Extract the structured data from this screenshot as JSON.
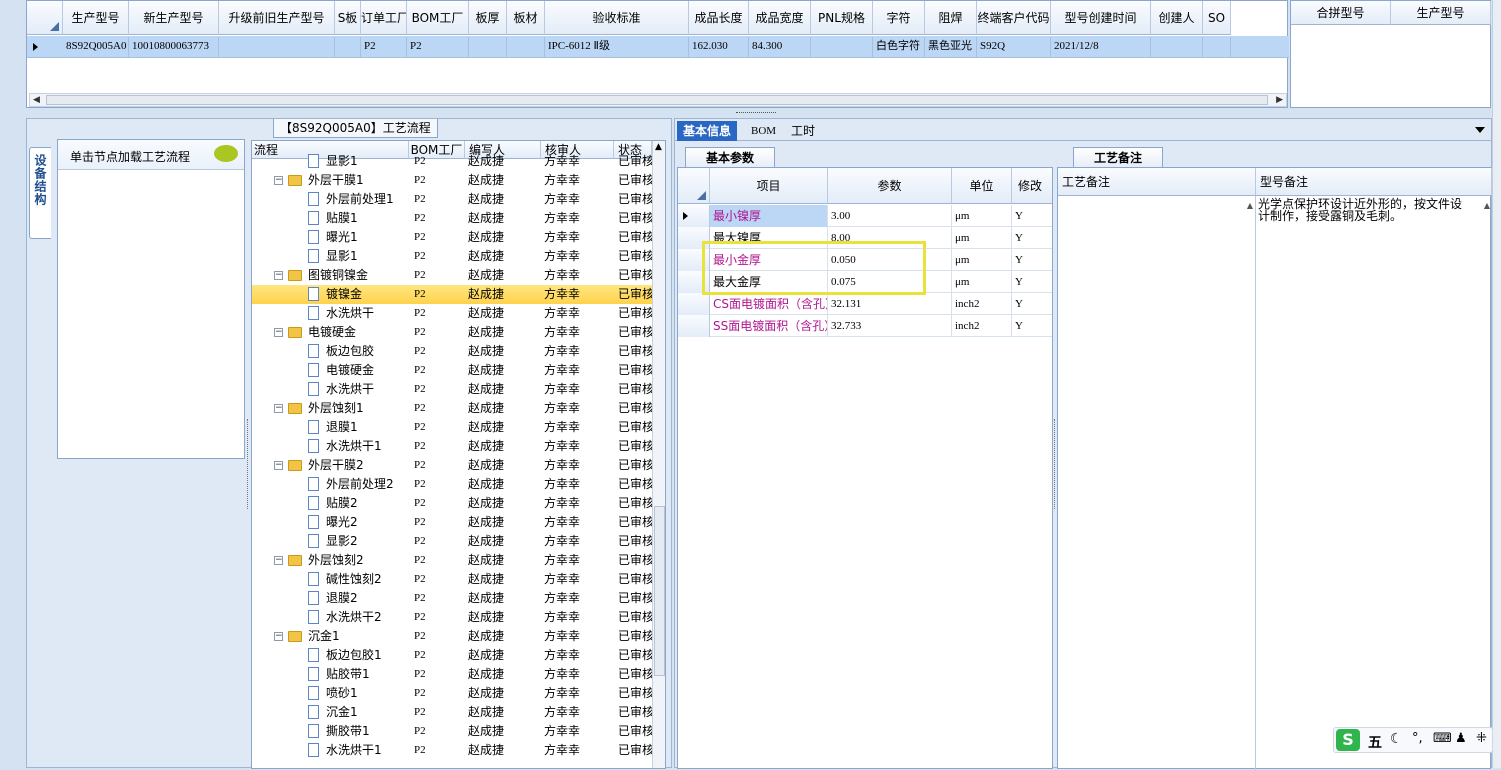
{
  "top_grid": {
    "columns": [
      "生产型号",
      "新生产型号",
      "升级前旧生产型号",
      "S板",
      "订单工厂",
      "BOM工厂",
      "板厚",
      "板材",
      "验收标准",
      "成品长度",
      "成品宽度",
      "PNL规格",
      "字符",
      "阻焊",
      "终端客户代码",
      "型号创建时间",
      "创建人",
      "SO"
    ],
    "row": [
      "8S92Q005A0",
      "10010800063773",
      "",
      "",
      "P2",
      "P2",
      "",
      "",
      "IPC-6012 Ⅱ级",
      "162.030",
      "84.300",
      "",
      "白色字符",
      "黑色亚光",
      "S92Q",
      "2021/12/8",
      "",
      ""
    ]
  },
  "side_grid": {
    "columns": [
      "合拼型号",
      "生产型号"
    ]
  },
  "process_panel": {
    "title": "【8S92Q005A0】工艺流程",
    "side_tab": "设备结构",
    "hint": "单击节点加载工艺流程",
    "columns": [
      "流程",
      "BOM工厂",
      "编写人",
      "核审人",
      "状态"
    ],
    "rows": [
      {
        "name": "显影1",
        "bom": "P2",
        "writer": "赵成捷",
        "reviewer": "方幸幸",
        "status": "已审核",
        "level": 2
      },
      {
        "name": "外层干膜1",
        "bom": "P2",
        "writer": "赵成捷",
        "reviewer": "方幸幸",
        "status": "已审核",
        "level": 1
      },
      {
        "name": "外层前处理1",
        "bom": "P2",
        "writer": "赵成捷",
        "reviewer": "方幸幸",
        "status": "已审核",
        "level": 2
      },
      {
        "name": "贴膜1",
        "bom": "P2",
        "writer": "赵成捷",
        "reviewer": "方幸幸",
        "status": "已审核",
        "level": 2
      },
      {
        "name": "曝光1",
        "bom": "P2",
        "writer": "赵成捷",
        "reviewer": "方幸幸",
        "status": "已审核",
        "level": 2
      },
      {
        "name": "显影1",
        "bom": "P2",
        "writer": "赵成捷",
        "reviewer": "方幸幸",
        "status": "已审核",
        "level": 2
      },
      {
        "name": "图镀铜镍金",
        "bom": "P2",
        "writer": "赵成捷",
        "reviewer": "方幸幸",
        "status": "已审核",
        "level": 1
      },
      {
        "name": "镀镍金",
        "bom": "P2",
        "writer": "赵成捷",
        "reviewer": "方幸幸",
        "status": "已审核",
        "level": 2,
        "selected": true
      },
      {
        "name": "水洗烘干",
        "bom": "P2",
        "writer": "赵成捷",
        "reviewer": "方幸幸",
        "status": "已审核",
        "level": 2
      },
      {
        "name": "电镀硬金",
        "bom": "P2",
        "writer": "赵成捷",
        "reviewer": "方幸幸",
        "status": "已审核",
        "level": 1
      },
      {
        "name": "板边包胶",
        "bom": "P2",
        "writer": "赵成捷",
        "reviewer": "方幸幸",
        "status": "已审核",
        "level": 2
      },
      {
        "name": "电镀硬金",
        "bom": "P2",
        "writer": "赵成捷",
        "reviewer": "方幸幸",
        "status": "已审核",
        "level": 2
      },
      {
        "name": "水洗烘干",
        "bom": "P2",
        "writer": "赵成捷",
        "reviewer": "方幸幸",
        "status": "已审核",
        "level": 2
      },
      {
        "name": "外层蚀刻1",
        "bom": "P2",
        "writer": "赵成捷",
        "reviewer": "方幸幸",
        "status": "已审核",
        "level": 1
      },
      {
        "name": "退膜1",
        "bom": "P2",
        "writer": "赵成捷",
        "reviewer": "方幸幸",
        "status": "已审核",
        "level": 2
      },
      {
        "name": "水洗烘干1",
        "bom": "P2",
        "writer": "赵成捷",
        "reviewer": "方幸幸",
        "status": "已审核",
        "level": 2
      },
      {
        "name": "外层干膜2",
        "bom": "P2",
        "writer": "赵成捷",
        "reviewer": "方幸幸",
        "status": "已审核",
        "level": 1
      },
      {
        "name": "外层前处理2",
        "bom": "P2",
        "writer": "赵成捷",
        "reviewer": "方幸幸",
        "status": "已审核",
        "level": 2
      },
      {
        "name": "贴膜2",
        "bom": "P2",
        "writer": "赵成捷",
        "reviewer": "方幸幸",
        "status": "已审核",
        "level": 2
      },
      {
        "name": "曝光2",
        "bom": "P2",
        "writer": "赵成捷",
        "reviewer": "方幸幸",
        "status": "已审核",
        "level": 2
      },
      {
        "name": "显影2",
        "bom": "P2",
        "writer": "赵成捷",
        "reviewer": "方幸幸",
        "status": "已审核",
        "level": 2
      },
      {
        "name": "外层蚀刻2",
        "bom": "P2",
        "writer": "赵成捷",
        "reviewer": "方幸幸",
        "status": "已审核",
        "level": 1
      },
      {
        "name": "碱性蚀刻2",
        "bom": "P2",
        "writer": "赵成捷",
        "reviewer": "方幸幸",
        "status": "已审核",
        "level": 2
      },
      {
        "name": "退膜2",
        "bom": "P2",
        "writer": "赵成捷",
        "reviewer": "方幸幸",
        "status": "已审核",
        "level": 2
      },
      {
        "name": "水洗烘干2",
        "bom": "P2",
        "writer": "赵成捷",
        "reviewer": "方幸幸",
        "status": "已审核",
        "level": 2
      },
      {
        "name": "沉金1",
        "bom": "P2",
        "writer": "赵成捷",
        "reviewer": "方幸幸",
        "status": "已审核",
        "level": 1
      },
      {
        "name": "板边包胶1",
        "bom": "P2",
        "writer": "赵成捷",
        "reviewer": "方幸幸",
        "status": "已审核",
        "level": 2
      },
      {
        "name": "贴胶带1",
        "bom": "P2",
        "writer": "赵成捷",
        "reviewer": "方幸幸",
        "status": "已审核",
        "level": 2
      },
      {
        "name": "喷砂1",
        "bom": "P2",
        "writer": "赵成捷",
        "reviewer": "方幸幸",
        "status": "已审核",
        "level": 2
      },
      {
        "name": "沉金1",
        "bom": "P2",
        "writer": "赵成捷",
        "reviewer": "方幸幸",
        "status": "已审核",
        "level": 2
      },
      {
        "name": "撕胶带1",
        "bom": "P2",
        "writer": "赵成捷",
        "reviewer": "方幸幸",
        "status": "已审核",
        "level": 2
      },
      {
        "name": "水洗烘干1",
        "bom": "P2",
        "writer": "赵成捷",
        "reviewer": "方幸幸",
        "status": "已审核",
        "level": 2
      }
    ]
  },
  "info_panel": {
    "tabs": [
      "基本信息",
      "BOM",
      "工时"
    ],
    "sub_tab": "基本参数",
    "columns": [
      "项目",
      "参数",
      "单位",
      "修改"
    ],
    "rows": [
      {
        "item": "最小镍厚",
        "value": "3.00",
        "unit": "μm",
        "mod": "Y",
        "color": "#b0158f"
      },
      {
        "item": "最大镍厚",
        "value": "8.00",
        "unit": "μm",
        "mod": "Y",
        "color": "#000000"
      },
      {
        "item": "最小金厚",
        "value": "0.050",
        "unit": "μm",
        "mod": "Y",
        "color": "#b0158f"
      },
      {
        "item": "最大金厚",
        "value": "0.075",
        "unit": "μm",
        "mod": "Y",
        "color": "#000000"
      },
      {
        "item": "CS面电镀面积（含孔）",
        "value": "32.131",
        "unit": "inch2",
        "mod": "Y",
        "color": "#b0158f"
      },
      {
        "item": "SS面电镀面积（含孔）",
        "value": "32.733",
        "unit": "inch2",
        "mod": "Y",
        "color": "#b0158f"
      }
    ]
  },
  "remark_panel": {
    "tab": "工艺备注",
    "columns": [
      "工艺备注",
      "型号备注"
    ],
    "model_remark": "光学点保护环设计近外形的，按文件设计制作，接受露铜及毛刺。"
  },
  "ime": {
    "label": "五"
  },
  "colors": {
    "accent": "#2a67c4",
    "highlight": "#ffe680",
    "frame": "#e8e23a"
  }
}
